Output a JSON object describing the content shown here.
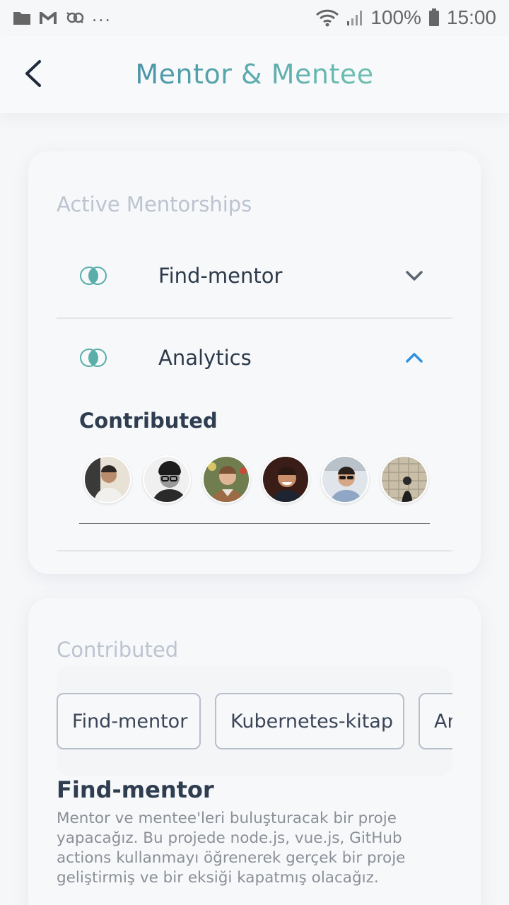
{
  "status_bar": {
    "icons_left": [
      "folder-icon",
      "gmail-icon",
      "sync-icon"
    ],
    "overflow": "...",
    "battery": "100%",
    "time": "15:00",
    "icons_right": [
      "wifi-icon",
      "signal-icon",
      "battery-icon"
    ]
  },
  "header": {
    "title": "Mentor & Mentee",
    "back_icon": "back-arrow-icon",
    "title_gradient": [
      "#4a95a8",
      "#6ec0b3"
    ]
  },
  "active_mentorships": {
    "title": "Active Mentorships",
    "items": [
      {
        "label": "Find-mentor",
        "icon": "overlap-circles-icon",
        "chevron": "chevron-down-icon",
        "expanded": false
      },
      {
        "label": "Analytics",
        "icon": "overlap-circles-icon",
        "chevron": "chevron-up-icon",
        "expanded": true
      }
    ],
    "contributed_heading": "Contributed",
    "avatars": [
      "contributor-1",
      "contributor-2",
      "contributor-3",
      "contributor-4",
      "contributor-5",
      "contributor-6"
    ]
  },
  "contributed": {
    "title": "Contributed",
    "chips": [
      "Find-mentor",
      "Kubernetes-kitap",
      "Analytics"
    ],
    "selected": {
      "title": "Find-mentor",
      "description": "Mentor ve mentee'leri buluşturacak bir proje yapacağız. Bu projede node.js, vue.js, GitHub actions kullanmayı öğrenerek gerçek bir proje geliştirmiş ve bir eksiği kapatmış olacağız."
    }
  },
  "colors": {
    "accent_teal": "#5aaea9",
    "chevron_blue": "#2f8fe0",
    "muted_title": "#bcc3d1"
  }
}
